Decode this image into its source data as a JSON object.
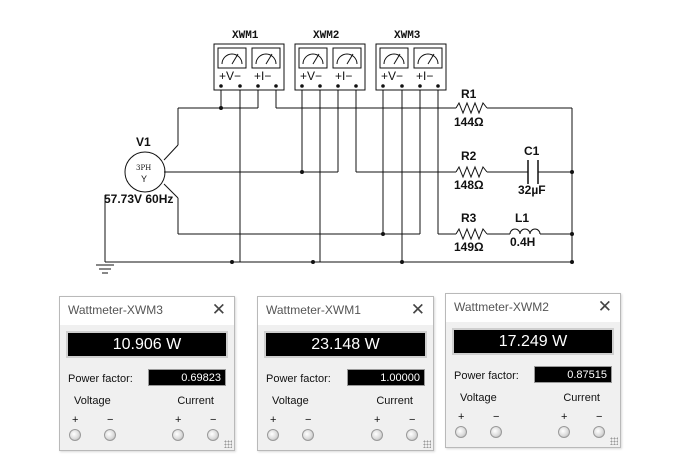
{
  "schematic": {
    "meters": [
      {
        "name": "XWM1",
        "v_terminal": "+V−",
        "i_terminal": "+I−"
      },
      {
        "name": "XWM2",
        "v_terminal": "+V−",
        "i_terminal": "+I−"
      },
      {
        "name": "XWM3",
        "v_terminal": "+V−",
        "i_terminal": "+I−"
      }
    ],
    "source": {
      "name": "V1",
      "type_label": "3PH",
      "connection": "Y",
      "rating": "57.73V 60Hz"
    },
    "components": {
      "r1": {
        "name": "R1",
        "value": "144Ω"
      },
      "r2": {
        "name": "R2",
        "value": "148Ω"
      },
      "r3": {
        "name": "R3",
        "value": "149Ω"
      },
      "c1": {
        "name": "C1",
        "value": "32µF"
      },
      "l1": {
        "name": "L1",
        "value": "0.4H"
      }
    }
  },
  "windows": [
    {
      "title": "Wattmeter-XWM3",
      "power": "10.906 W",
      "pf_label": "Power factor:",
      "pf": "0.69823",
      "voltage_label": "Voltage",
      "current_label": "Current",
      "plus": "+",
      "minus": "−",
      "close": "✕"
    },
    {
      "title": "Wattmeter-XWM1",
      "power": "23.148 W",
      "pf_label": "Power factor:",
      "pf": "1.00000",
      "voltage_label": "Voltage",
      "current_label": "Current",
      "plus": "+",
      "minus": "−",
      "close": "✕"
    },
    {
      "title": "Wattmeter-XWM2",
      "power": "17.249 W",
      "pf_label": "Power factor:",
      "pf": "0.87515",
      "voltage_label": "Voltage",
      "current_label": "Current",
      "plus": "+",
      "minus": "−",
      "close": "✕"
    }
  ]
}
